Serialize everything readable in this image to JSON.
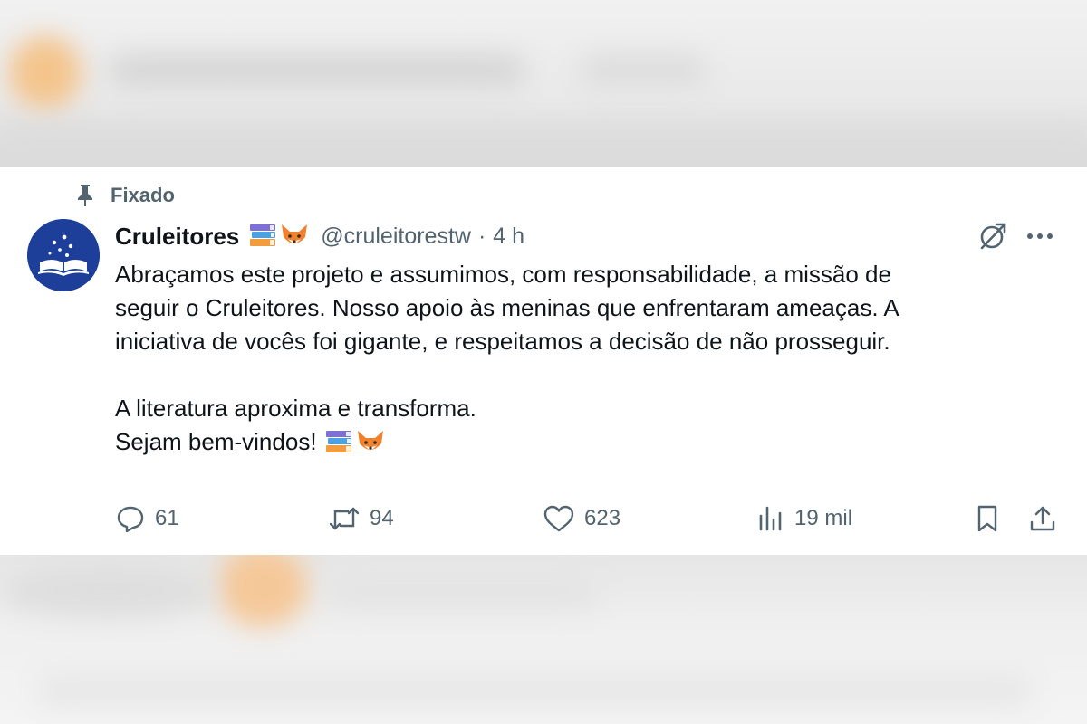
{
  "tweet": {
    "pinned_label": "Fixado",
    "author": {
      "display_name": "Cruleitores",
      "handle": "@cruleitorestw",
      "separator": "·",
      "time": "4 h",
      "name_emojis": [
        "books-emoji",
        "fox-emoji"
      ]
    },
    "text_lines": [
      "Abraçamos este projeto e assumimos, com responsabilidade, a missão de",
      "seguir o Cruleitores. Nosso apoio às meninas que enfrentaram ameaças. A",
      "iniciativa de vocês foi gigante, e respeitamos a decisão de não prosseguir.",
      "",
      "A literatura aproxima e transforma.",
      "Sejam bem-vindos!"
    ],
    "actions": {
      "replies": "61",
      "reposts": "94",
      "likes": "623",
      "views": "19 mil"
    },
    "icons": [
      "pin-icon",
      "grok-icon",
      "more-icon",
      "reply-icon",
      "repost-icon",
      "like-icon",
      "views-icon",
      "bookmark-icon",
      "share-icon"
    ],
    "colors": {
      "text": "#0f1419",
      "secondary": "#536471",
      "avatar_bg": "#1d3f9a"
    }
  }
}
